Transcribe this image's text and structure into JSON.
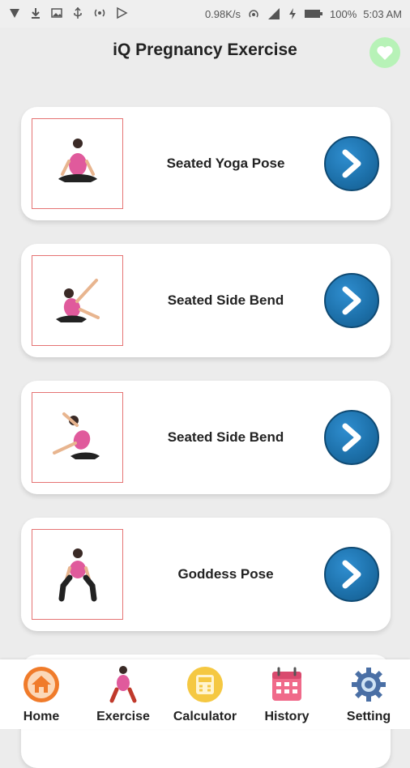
{
  "status_bar": {
    "speed": "0.98K/s",
    "battery": "100%",
    "time": "5:03 AM"
  },
  "header": {
    "title": "iQ Pregnancy Exercise",
    "favorite_icon": "heart-icon"
  },
  "exercises": [
    {
      "label": "Seated Yoga Pose",
      "pose": "seated-meditation"
    },
    {
      "label": "Seated Side Bend",
      "pose": "side-bend-left"
    },
    {
      "label": "Seated Side Bend",
      "pose": "side-bend-right"
    },
    {
      "label": "Goddess Pose",
      "pose": "goddess"
    }
  ],
  "bottom_nav": [
    {
      "label": "Home",
      "icon": "home-icon"
    },
    {
      "label": "Exercise",
      "icon": "exercise-icon"
    },
    {
      "label": "Calculator",
      "icon": "calculator-icon"
    },
    {
      "label": "History",
      "icon": "calendar-icon"
    },
    {
      "label": "Setting",
      "icon": "gear-icon"
    }
  ],
  "colors": {
    "accent_blue": "#1c6fa8",
    "thumb_border": "#e57373",
    "fav_bg": "#b7f2b7"
  }
}
